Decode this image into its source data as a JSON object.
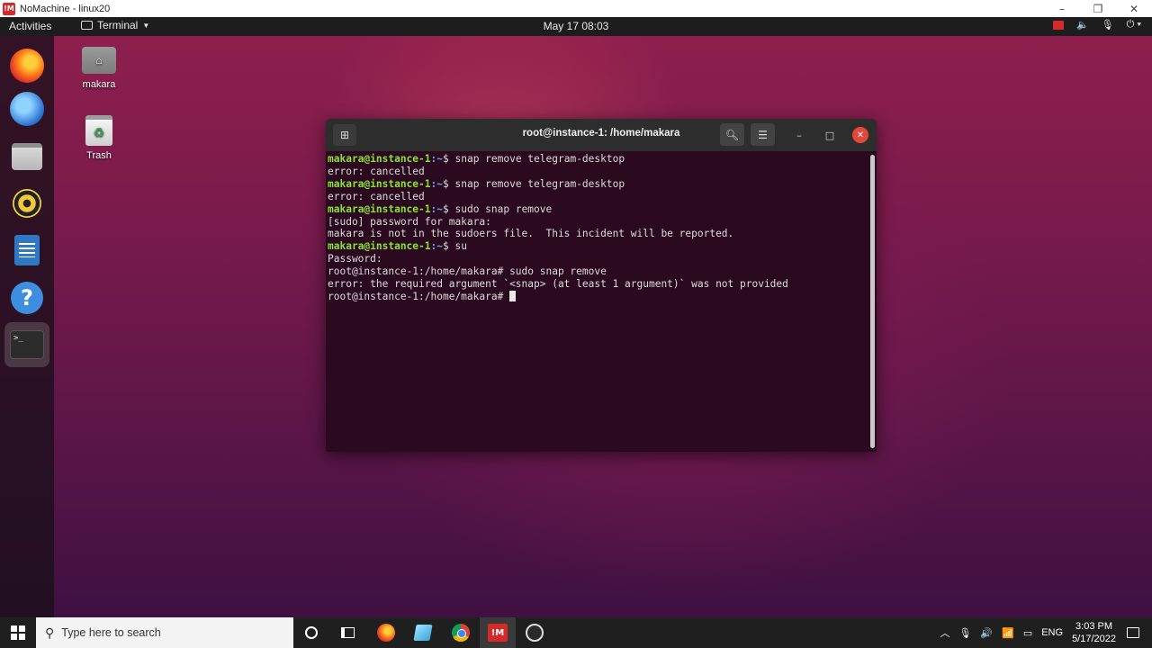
{
  "nomachine": {
    "logo_text": "!M",
    "title": "NoMachine - linux20",
    "minimize_icon": "minimize-icon",
    "restore_icon": "restore-icon",
    "close_icon": "close-icon"
  },
  "topbar": {
    "activities": "Activities",
    "app_name": "Terminal",
    "datetime": "May 17  08:03"
  },
  "desktop_icons": [
    {
      "label": "makara",
      "icon": "home-folder-icon"
    },
    {
      "label": "Trash",
      "icon": "trash-icon"
    }
  ],
  "dock": {
    "items": [
      "firefox-icon",
      "thunderbird-icon",
      "files-icon",
      "rhythmbox-icon",
      "libreoffice-writer-icon",
      "help-icon",
      "terminal-icon"
    ],
    "help_glyph": "?",
    "terminal_glyph": ">_"
  },
  "terminal": {
    "title": "root@instance-1: /home/makara",
    "user_prompt": "makara@instance-1",
    "user_path": ":~$",
    "root_prompt": "root@instance-1:/home/makara#",
    "lines": [
      {
        "type": "user",
        "cmd": " snap remove telegram-desktop"
      },
      {
        "type": "out",
        "text": "error: cancelled"
      },
      {
        "type": "user",
        "cmd": " snap remove telegram-desktop"
      },
      {
        "type": "out",
        "text": "error: cancelled"
      },
      {
        "type": "user",
        "cmd": " sudo snap remove"
      },
      {
        "type": "out",
        "text": "[sudo] password for makara:"
      },
      {
        "type": "out",
        "text": "makara is not in the sudoers file.  This incident will be reported."
      },
      {
        "type": "user",
        "cmd": " su"
      },
      {
        "type": "out",
        "text": "Password:"
      },
      {
        "type": "root",
        "cmd": " sudo snap remove"
      },
      {
        "type": "out",
        "text": "error: the required argument `<snap> (at least 1 argument)` was not provided"
      },
      {
        "type": "root",
        "cmd": " "
      }
    ]
  },
  "taskbar": {
    "search_placeholder": "Type here to search",
    "nomachine_label": "!M",
    "language": "ENG",
    "time": "3:03 PM",
    "date": "5/17/2022"
  },
  "colors": {
    "prompt_user": "#8ae234",
    "prompt_path": "#6aa0e6",
    "terminal_bg": "#2b0a20",
    "close_button": "#e4483a"
  }
}
